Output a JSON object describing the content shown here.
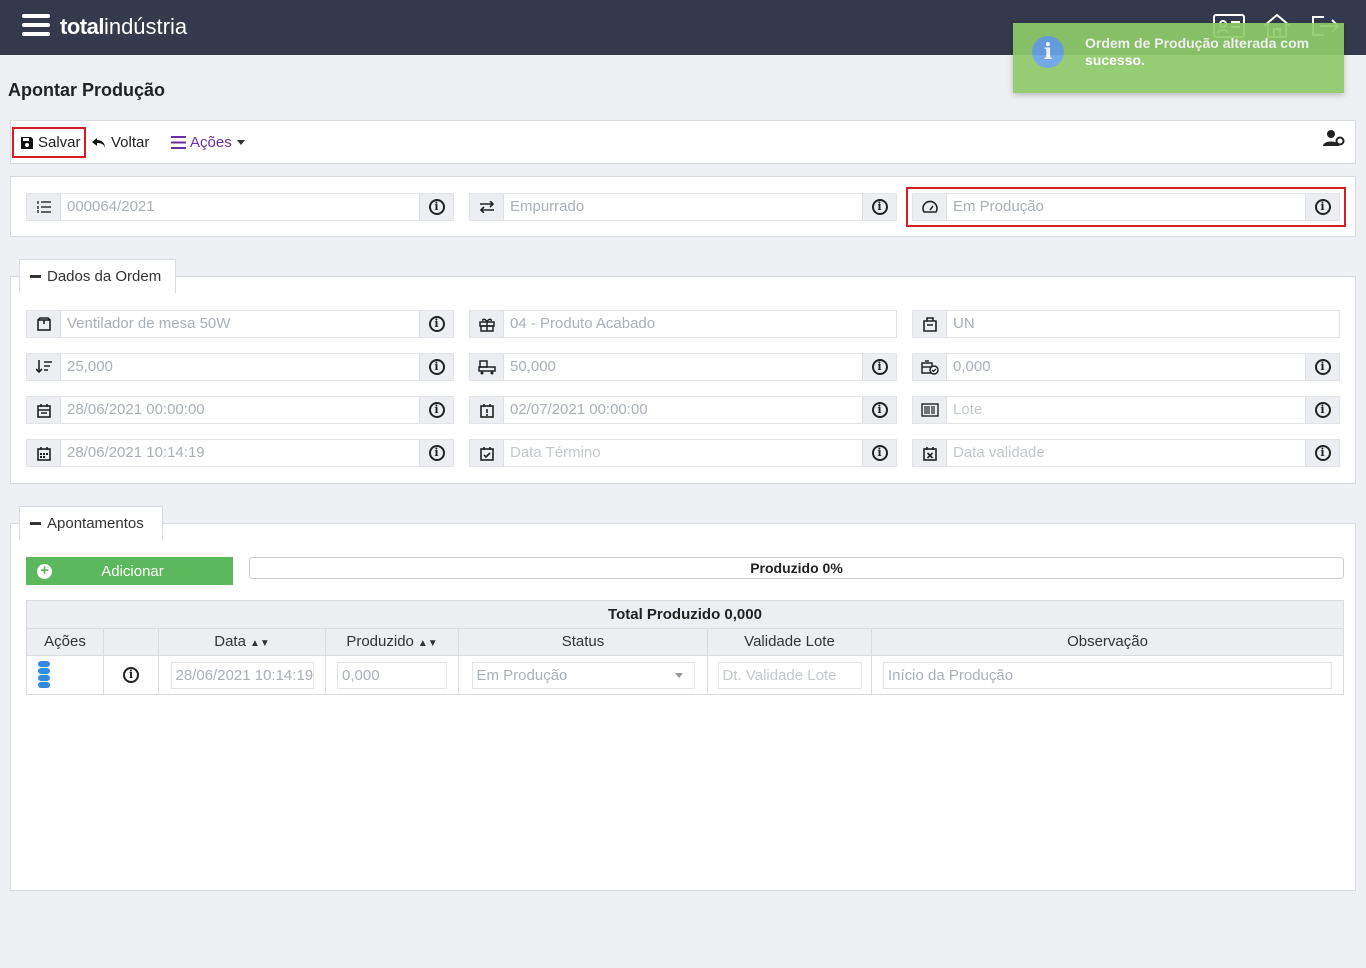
{
  "app": {
    "logo_bold": "total",
    "logo_light": "indústria"
  },
  "toast": {
    "message": "Ordem de Produção alterada com sucesso."
  },
  "page": {
    "title": "Apontar Produção"
  },
  "toolbar": {
    "save_label": "Salvar",
    "back_label": "Voltar",
    "actions_label": "Ações"
  },
  "header_fields": {
    "order_number": "000064/2021",
    "type": "Empurrado",
    "status": "Em Produção"
  },
  "order_section": {
    "title": "Dados da Ordem",
    "product": "Ventilador de mesa 50W",
    "product_type": "04 - Produto Acabado",
    "unit": "UN",
    "qty_planned": "25,000",
    "qty_capacity": "50,000",
    "qty_produced": "0,000",
    "date_start": "28/06/2021 00:00:00",
    "date_due": "02/07/2021 00:00:00",
    "lot_placeholder": "Lote",
    "date_started": "28/06/2021 10:14:19",
    "date_end_placeholder": "Data Término",
    "validity_placeholder": "Data validade"
  },
  "appointments": {
    "title": "Apontamentos",
    "add_label": "Adicionar",
    "progress_label": "Produzido 0%",
    "progress_value": 0,
    "total_label": "Total Produzido 0,000",
    "columns": [
      "Ações",
      "",
      "Data",
      "Produzido",
      "Status",
      "Validade Lote",
      "Observação"
    ],
    "rows": [
      {
        "date": "28/06/2021 10:14:19",
        "produced": "0,000",
        "status": "Em Produção",
        "validity_placeholder": "Dt. Validade Lote",
        "observation": "Início da Produção"
      }
    ]
  },
  "colors": {
    "topbar": "#343a4b",
    "accent_green": "#5cb85c",
    "highlight_red": "#d21f26",
    "actions_purple": "#6b2fa1"
  }
}
